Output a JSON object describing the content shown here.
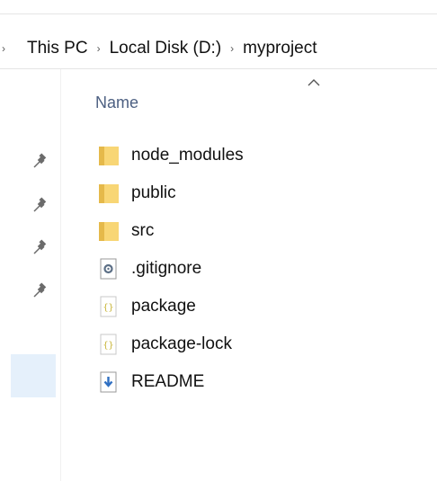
{
  "breadcrumb": {
    "items": [
      {
        "label": "This PC"
      },
      {
        "label": "Local Disk (D:)"
      },
      {
        "label": "myproject"
      }
    ]
  },
  "columns": {
    "name_label": "Name",
    "sort": "ascending"
  },
  "quick_access": {
    "pinned_count": 4
  },
  "files": [
    {
      "name": "node_modules",
      "type": "folder",
      "icon": "folder-icon"
    },
    {
      "name": "public",
      "type": "folder",
      "icon": "folder-icon"
    },
    {
      "name": "src",
      "type": "folder",
      "icon": "folder-icon"
    },
    {
      "name": ".gitignore",
      "type": "config file",
      "icon": "gear-file-icon"
    },
    {
      "name": "package",
      "type": "json file",
      "icon": "json-file-icon"
    },
    {
      "name": "package-lock",
      "type": "json file",
      "icon": "json-file-icon"
    },
    {
      "name": "README",
      "type": "markdown file",
      "icon": "markdown-file-icon"
    }
  ],
  "colors": {
    "folder": "#f8d675",
    "folder_dark": "#e5b94a",
    "header_text": "#4d6082",
    "selection": "#e5f0fb"
  }
}
